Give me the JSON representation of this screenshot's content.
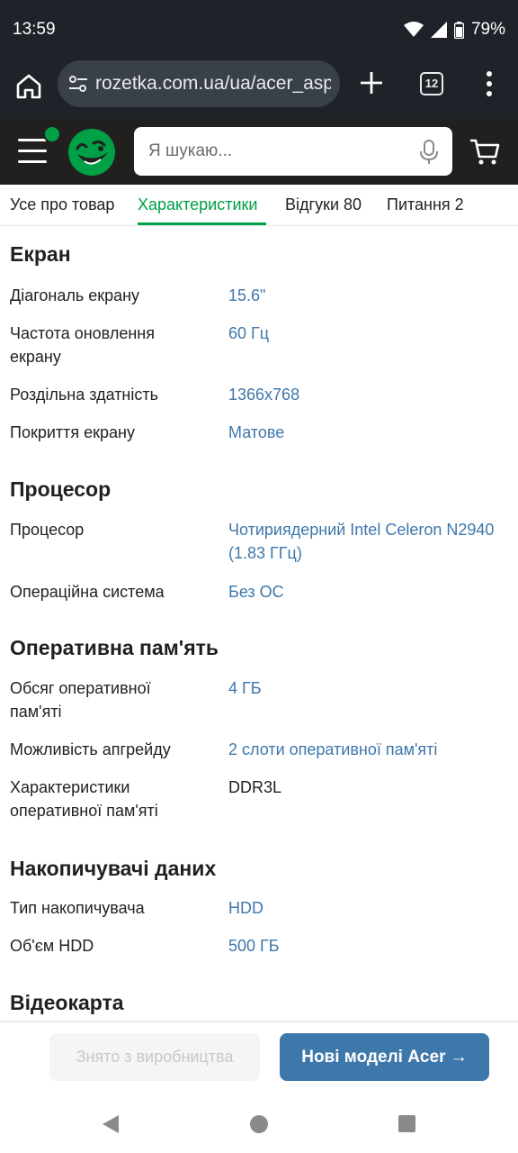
{
  "status": {
    "time": "13:59",
    "battery": "79%"
  },
  "browser": {
    "url": "rozetka.com.ua/ua/acer_aspire",
    "tab_count": "12"
  },
  "header": {
    "search_placeholder": "Я шукаю..."
  },
  "tabs": [
    {
      "label": "Усе про товар"
    },
    {
      "label": "Характеристики"
    },
    {
      "label": "Відгуки 80"
    },
    {
      "label": "Питання 2"
    }
  ],
  "sections": [
    {
      "title": "Екран",
      "rows": [
        {
          "label": "Діагональ екрану",
          "value": "15.6\""
        },
        {
          "label": "Частота оновлення екрану",
          "value": "60 Гц"
        },
        {
          "label": "Роздільна здатність",
          "value": "1366x768"
        },
        {
          "label": "Покриття екрану",
          "value": "Матове"
        }
      ]
    },
    {
      "title": "Процесор",
      "rows": [
        {
          "label": "Процесор",
          "value": "Чотириядерний Intel Celeron N2940 (1.83 ГГц)"
        },
        {
          "label": "Операційна система",
          "value": "Без ОС"
        }
      ]
    },
    {
      "title": "Оперативна пам'ять",
      "rows": [
        {
          "label": "Обсяг оперативної пам'яті",
          "value": "4 ГБ"
        },
        {
          "label": "Можливість апгрейду",
          "value": "2 слоти оперативної пам'яті"
        },
        {
          "label": "Характеристики оперативної пам'яті",
          "value": "DDR3L"
        }
      ]
    },
    {
      "title": "Накопичувачі даних",
      "rows": [
        {
          "label": "Тип накопичувача",
          "value": "HDD"
        },
        {
          "label": "Об'єм HDD",
          "value": "500 ГБ"
        }
      ]
    },
    {
      "title": "Відеокарта",
      "rows": []
    }
  ],
  "actions": {
    "discontinued": "Знято з виробництва",
    "new_models": "Нові моделі Acer →"
  },
  "colors": {
    "brand_green": "#00a046",
    "link_blue": "#3e77aa",
    "header_dark": "#221f1f"
  }
}
